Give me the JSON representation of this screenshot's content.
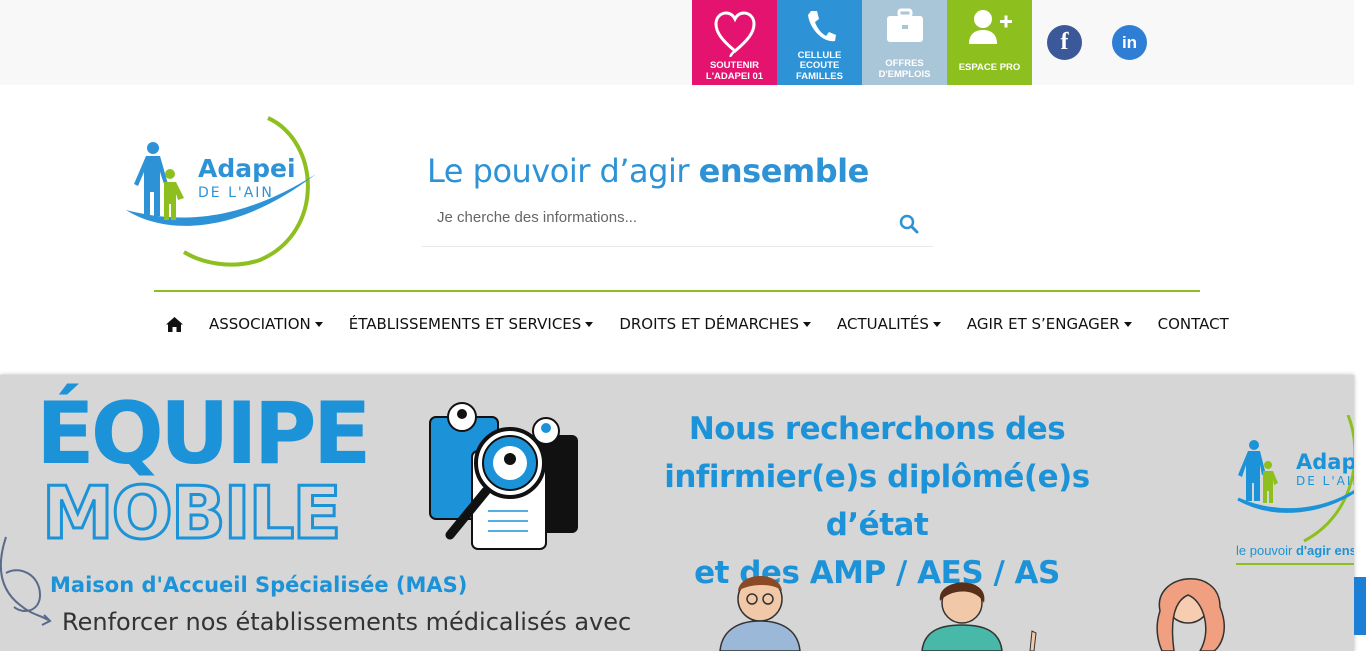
{
  "topbar": {
    "tiles": [
      {
        "label": "SOUTENIR L'ADAPEI 01",
        "icon": "heart-icon",
        "color": "#e3136f"
      },
      {
        "label": "CELLULE ECOUTE FAMILLES",
        "icon": "phone-icon",
        "color": "#2e93d6"
      },
      {
        "label": "OFFRES D'EMPLOIS",
        "icon": "briefcase-icon",
        "color": "#a8c6d8"
      },
      {
        "label": "ESPACE PRO",
        "icon": "user-plus-icon",
        "color": "#8dbf1f"
      }
    ],
    "social": [
      {
        "label": "f",
        "icon": "facebook-icon",
        "color": "#3b5998"
      },
      {
        "label": "in",
        "icon": "linkedin-icon",
        "color": "#2e7ed6"
      }
    ]
  },
  "logo": {
    "name": "Adapei",
    "sub": "DE L'AIN"
  },
  "slogan": {
    "regular": "Le pouvoir d’agir ",
    "bold": "ensemble"
  },
  "search": {
    "placeholder": "Je cherche des informations...",
    "icon": "search-icon"
  },
  "nav": {
    "home_icon": "home-icon",
    "items": [
      {
        "label": "ASSOCIATION",
        "dropdown": true
      },
      {
        "label": "ÉTABLISSEMENTS ET SERVICES",
        "dropdown": true
      },
      {
        "label": "DROITS ET DÉMARCHES",
        "dropdown": true
      },
      {
        "label": "ACTUALITÉS",
        "dropdown": true
      },
      {
        "label": "AGIR ET S’ENGAGER",
        "dropdown": true
      },
      {
        "label": "CONTACT",
        "dropdown": false
      }
    ]
  },
  "banner": {
    "title_line1": "ÉQUIPE",
    "title_line2": "MOBILE",
    "subtitle": "Maison d'Accueil Spécialisée (MAS)",
    "text": "Renforcer nos établissements médicalisés avec",
    "headline": [
      "Nous recherchons des",
      "infirmier(e)s diplômé(e)s d’état",
      "et des AMP / AES / AS"
    ],
    "logo_name": "Adapei",
    "logo_sub": "DE L'AIN",
    "slogan_regular": "le pouvoir ",
    "slogan_bold": "d'agir ens"
  },
  "colors": {
    "blue": "#2e93d6",
    "green": "#8dbf1f",
    "pink": "#e3136f",
    "banner_bg": "#d6d6d6"
  }
}
